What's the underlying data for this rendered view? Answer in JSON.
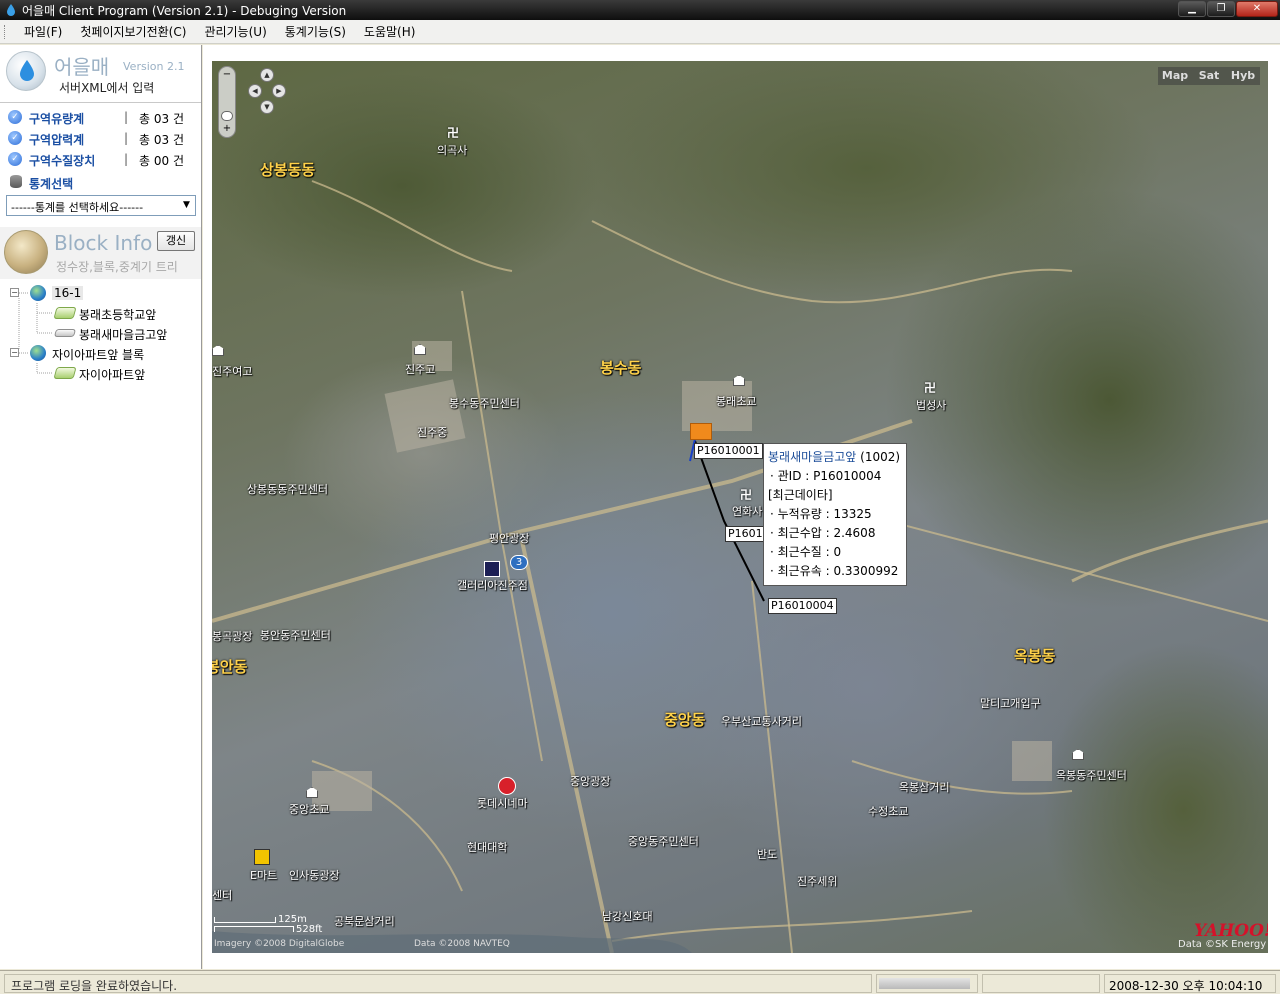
{
  "window": {
    "title": "어을매 Client Program (Version 2.1) - Debuging Version"
  },
  "menu": {
    "items": [
      {
        "label": "파일(F)"
      },
      {
        "label": "첫페이지보기전환(C)"
      },
      {
        "label": "관리기능(U)"
      },
      {
        "label": "통계기능(S)"
      },
      {
        "label": "도움말(H)"
      }
    ]
  },
  "brand": {
    "name": "어을매",
    "version": "Version 2.1",
    "subtitle": "서버XML에서 입력"
  },
  "stats": [
    {
      "label": "구역유량계",
      "count": "총 03 건"
    },
    {
      "label": "구역압력계",
      "count": "총 03 건"
    },
    {
      "label": "구역수질장치",
      "count": "총 00 건"
    }
  ],
  "stat_select": {
    "title": "통계선택",
    "placeholder": "------통계를 선택하세요------"
  },
  "block_info": {
    "title": "Block Info",
    "subtitle": "정수장,블록,중계기 트리",
    "refresh_label": "갱신"
  },
  "tree": {
    "nodes": [
      {
        "label": "16-1",
        "children": [
          {
            "label": "봉래초등학교앞"
          },
          {
            "label": "봉래새마을금고앞"
          }
        ]
      },
      {
        "label": "자이아파트앞 블록",
        "children": [
          {
            "label": "자이아파트앞"
          }
        ]
      }
    ]
  },
  "map": {
    "types": [
      "Map",
      "Sat",
      "Hyb"
    ],
    "places": [
      "상봉동동",
      "봉수동",
      "봉안동",
      "중앙동",
      "옥봉동"
    ],
    "pois": [
      "의곡사",
      "진주고",
      "봉수동주민센터",
      "봉래초교",
      "법성사",
      "진주중",
      "상봉동동주민센터",
      "평안광장",
      "연화사",
      "갤러리아진주점",
      "봉곡광장",
      "봉안동주민센터",
      "우부산교통사거리",
      "말티고개입구",
      "중앙광장",
      "옥봉삼거리",
      "옥봉동주민센터",
      "수정초교",
      "중앙초교",
      "롯데시네마",
      "현대대학",
      "중앙동주민센터",
      "반도",
      "진주세위",
      "E마트",
      "인사동광장",
      "공북문삼거리",
      "남강신호대",
      "진주여고",
      "센터"
    ],
    "route_badge": "3",
    "pipe_labels": [
      "P16010001",
      "P1601",
      "P16010004"
    ],
    "info_window": {
      "title": "봉래새마을금고앞",
      "code": "(1002)",
      "pipe_id": "· 관ID : P16010004",
      "recent_header": "[최근데이타]",
      "flow": "· 누적유량 : 13325",
      "pressure": "· 최근수압 : 2.4608",
      "quality": "· 최근수질 : 0",
      "velocity": "· 최근유속 : 0.3300992"
    },
    "scale": {
      "metric": "125m",
      "imperial": "528ft"
    },
    "imagery_credit": "Imagery ©2008 DigitalGlobe",
    "data_credit": "Data ©2008 NAVTEQ",
    "provider_logo": "YAHOO!",
    "provider_data": "Data ©SK Energy"
  },
  "status": {
    "message": "프로그램 로딩을 완료하였습니다.",
    "progress": 0.95,
    "datetime": "2008-12-30 오후 10:04:10"
  },
  "colors": {
    "accent_blue": "#1b4fa3",
    "place_label": "#ffd24a",
    "marker_orange": "#f08a1c"
  }
}
